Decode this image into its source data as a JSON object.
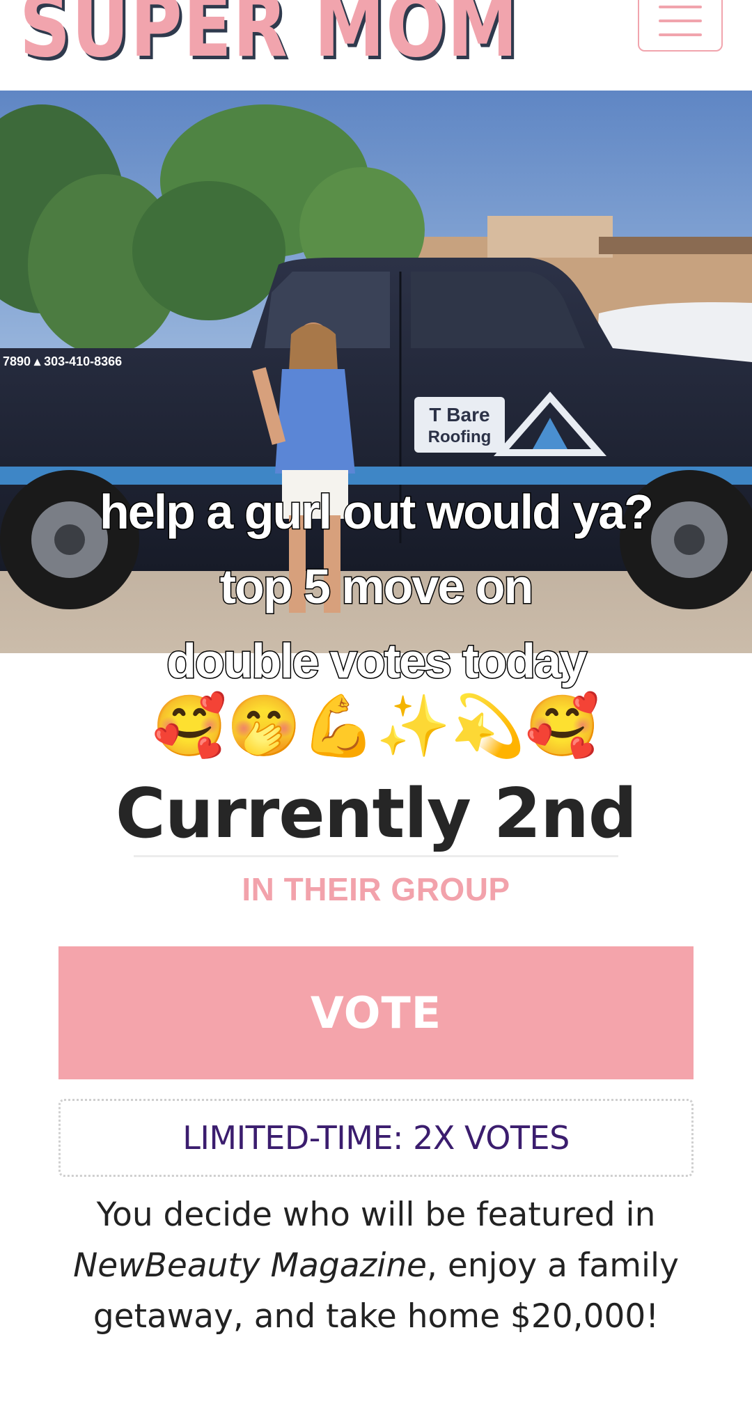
{
  "header": {
    "logo_text": "SUPER MOM",
    "menu_icon": "hamburger-menu-icon",
    "brand_pink": "#f1a4ad",
    "brand_navy": "#2f3a4d"
  },
  "hero": {
    "truck_phone_text": "7890 ▴ 303-410-8366",
    "truck_logo_line1": "T Bare",
    "truck_logo_line2": "Roofing"
  },
  "overlay": {
    "line1": "help a gurl out would ya?",
    "line2": "top 5 move on",
    "line3": "double votes today",
    "emojis": "🥰🤭💪✨💫🥰"
  },
  "standing": {
    "rank_text": "Currently 2nd",
    "group_text": "IN THEIR GROUP"
  },
  "vote": {
    "button_label": "VOTE",
    "button_color": "#f4a4ab"
  },
  "promo": {
    "text": "LIMITED-TIME: 2X VOTES",
    "text_color": "#3b1d6e"
  },
  "description": {
    "part1": "You decide who will be featured in ",
    "magazine": "NewBeauty Magazine",
    "part2": ", enjoy a family getaway, and take home $20,000!"
  }
}
